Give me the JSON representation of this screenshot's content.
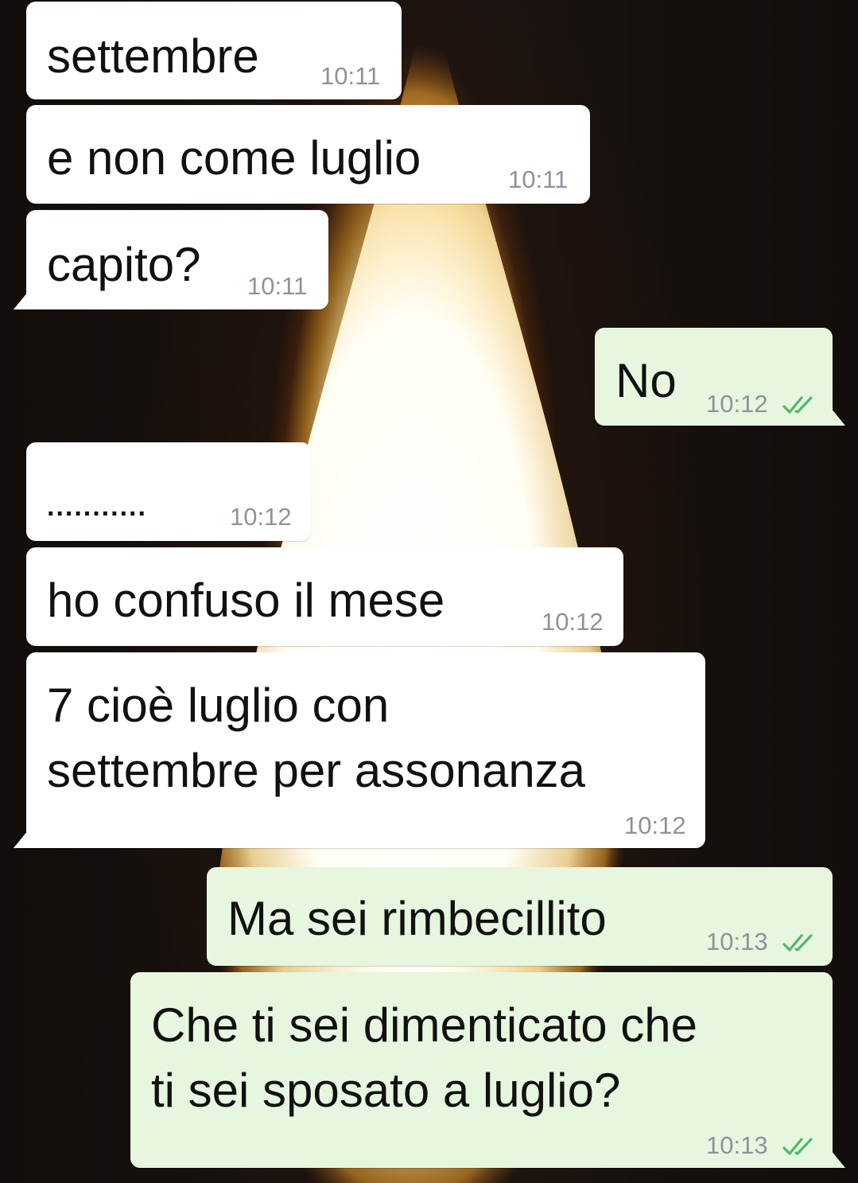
{
  "chat": {
    "messages": [
      {
        "direction": "incoming",
        "text": "settembre",
        "time": "10:11"
      },
      {
        "direction": "incoming",
        "text": "e non come luglio",
        "time": "10:11"
      },
      {
        "direction": "incoming",
        "text": "capito?",
        "time": "10:11"
      },
      {
        "direction": "outgoing",
        "text": "No",
        "time": "10:12",
        "status": "read"
      },
      {
        "direction": "incoming",
        "text": "...........",
        "time": "10:12"
      },
      {
        "direction": "incoming",
        "text": "ho confuso il mese",
        "time": "10:12"
      },
      {
        "direction": "incoming",
        "text_lines": [
          "7 cioè luglio con",
          "settembre per assonanza"
        ],
        "time": "10:12"
      },
      {
        "direction": "outgoing",
        "text": "Ma sei rimbecillito",
        "time": "10:13",
        "status": "read"
      },
      {
        "direction": "outgoing",
        "text_lines": [
          "Che ti sei dimenticato che",
          "ti sei sposato a luglio?"
        ],
        "time": "10:13",
        "status": "read"
      }
    ]
  },
  "colors": {
    "incoming_bubble": "#ffffff",
    "outgoing_bubble": "#e7f6df",
    "timestamp": "#8d9398",
    "read_check": "#4fb86a"
  },
  "icons": {
    "read_receipt": "double-check-icon"
  }
}
